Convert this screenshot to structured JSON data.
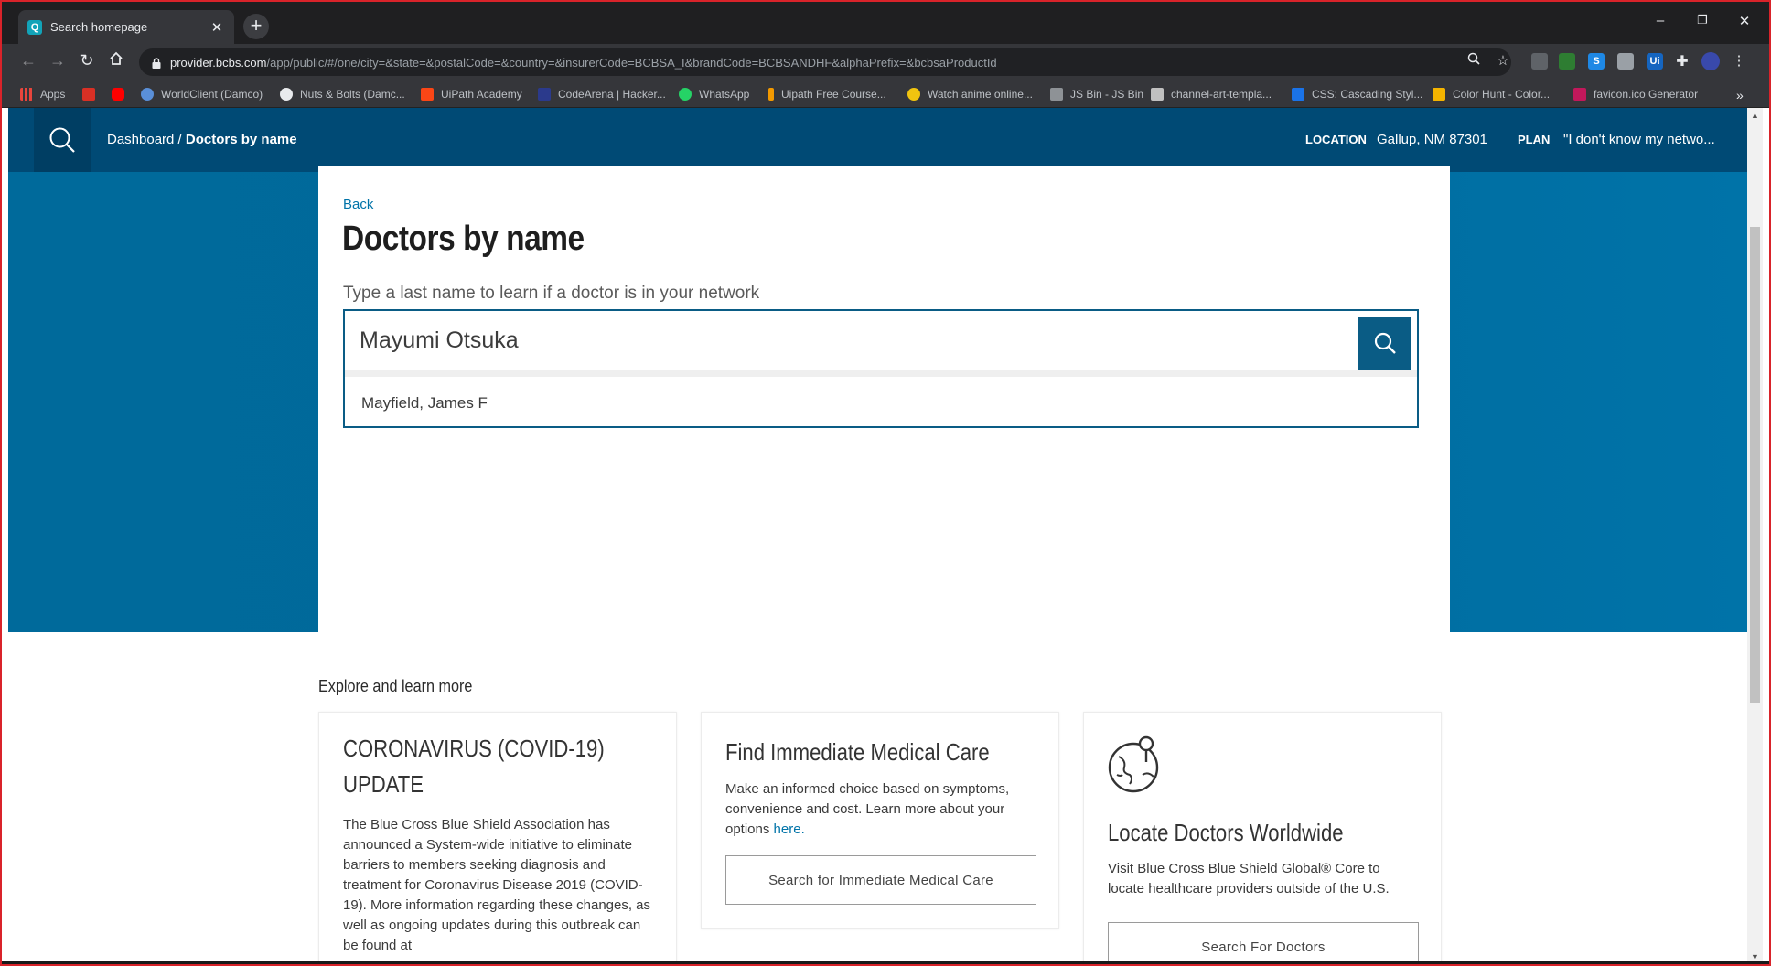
{
  "browser": {
    "tab_title": "Search homepage",
    "tab_favicon": "Q",
    "url_host": "provider.bcbs.com",
    "url_path": "/app/public/#/one/city=&state=&postalCode=&country=&insurerCode=BCBSA_I&brandCode=BCBSANDHF&alphaPrefix=&bcbsaProductId",
    "window_controls": [
      "–",
      "❐",
      "✕"
    ]
  },
  "bookmarks": [
    {
      "label": "Apps",
      "color": "#e8453c"
    },
    {
      "label": "",
      "color": "#d93025"
    },
    {
      "label": "",
      "color": "#ff0000"
    },
    {
      "label": "WorldClient (Damco)",
      "color": "#5a8fd8"
    },
    {
      "label": "Nuts & Bolts (Damc...",
      "color": "#e8eaed"
    },
    {
      "label": "UiPath Academy",
      "color": "#fa4616"
    },
    {
      "label": "CodeArena | Hacker...",
      "color": "#2b3a8c"
    },
    {
      "label": "WhatsApp",
      "color": "#25d366"
    },
    {
      "label": "Uipath Free Course...",
      "color": "#f29900"
    },
    {
      "label": "Watch anime online...",
      "color": "#f1c40f"
    },
    {
      "label": "JS Bin - JS Bin",
      "color": "#8e9296"
    },
    {
      "label": "channel-art-templa...",
      "color": "#c0c0c0"
    },
    {
      "label": "CSS: Cascading Styl...",
      "color": "#1a73e8"
    },
    {
      "label": "Color Hunt - Color...",
      "color": "#f4b400"
    },
    {
      "label": "favicon.ico Generator",
      "color": "#c2185b"
    }
  ],
  "site": {
    "breadcrumb_root": "Dashboard",
    "breadcrumb_sep": " / ",
    "breadcrumb_current": "Doctors by name",
    "location_label": "LOCATION",
    "location_value": "Gallup, NM 87301",
    "plan_label": "PLAN",
    "plan_value": "\"I don't know my netwo..."
  },
  "main": {
    "back": "Back",
    "title": "Doctors by name",
    "prompt": "Type a last name to learn if a doctor is in your network",
    "search_value": "Mayumi Otsuka",
    "suggestion": "Mayfield, James F"
  },
  "explore": {
    "heading": "Explore and learn more",
    "cards": [
      {
        "title_line1": "CORONAVIRUS (COVID-19)",
        "title_line2": "UPDATE",
        "body": "The Blue Cross Blue Shield Association has announced a System-wide initiative to eliminate barriers to members seeking diagnosis and treatment for Coronavirus Disease 2019 (COVID-19). More information regarding these changes, as well as ongoing updates during this outbreak can be found at"
      },
      {
        "title": "Find Immediate Medical Care",
        "body": "Make an informed choice based on symptoms, convenience and cost. Learn more about your options ",
        "link": "here.",
        "button": "Search for Immediate Medical Care"
      },
      {
        "title": "Locate Doctors Worldwide",
        "body": "Visit Blue Cross Blue Shield Global® Core to locate healthcare providers outside of the U.S.",
        "button": "Search For Doctors"
      }
    ]
  }
}
